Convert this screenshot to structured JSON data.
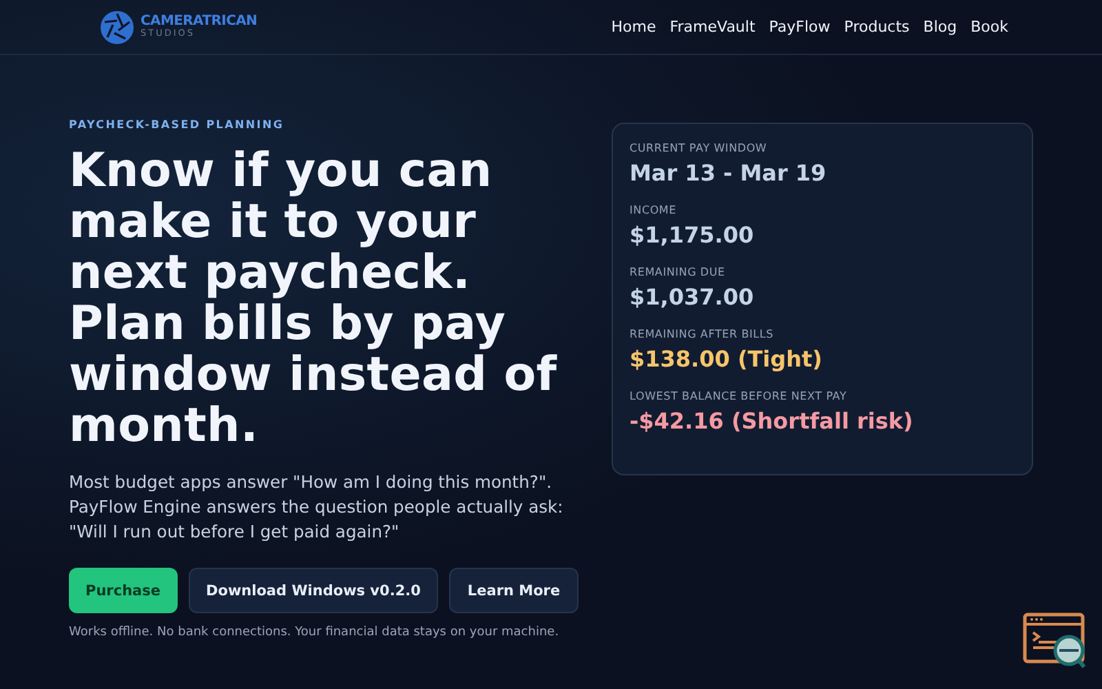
{
  "brand": {
    "name": "CAMERATRICAN",
    "sub": "STUDIOS"
  },
  "nav": [
    "Home",
    "FrameVault",
    "PayFlow",
    "Products",
    "Blog",
    "Book"
  ],
  "hero": {
    "eyebrow": "PAYCHECK-BASED PLANNING",
    "title": "Know if you can make it to your next paycheck. Plan bills by pay window instead of month.",
    "lead": "Most budget apps answer \"How am I doing this month?\". PayFlow Engine answers the question people actually ask: \"Will I run out before I get paid again?\"",
    "buttons": [
      {
        "label": "Purchase",
        "kind": "primary"
      },
      {
        "label": "Download Windows v0.2.0",
        "kind": "secondary"
      },
      {
        "label": "Learn More",
        "kind": "secondary"
      }
    ],
    "note": "Works offline. No bank connections. Your financial data stays on your machine."
  },
  "summary": [
    {
      "label": "CURRENT PAY WINDOW",
      "value": "Mar 13 - Mar 19",
      "color": "#c5d3e8"
    },
    {
      "label": "INCOME",
      "value": "$1,175.00",
      "color": "#c5d3e8"
    },
    {
      "label": "REMAINING DUE",
      "value": "$1,037.00",
      "color": "#c5d3e8"
    },
    {
      "label": "REMAINING AFTER BILLS",
      "value": "$138.00 (Tight)",
      "color": "#f6c56b"
    },
    {
      "label": "LOWEST BALANCE BEFORE NEXT PAY",
      "value": "-$42.16 (Shortfall risk)",
      "color": "#f59aa3"
    }
  ]
}
